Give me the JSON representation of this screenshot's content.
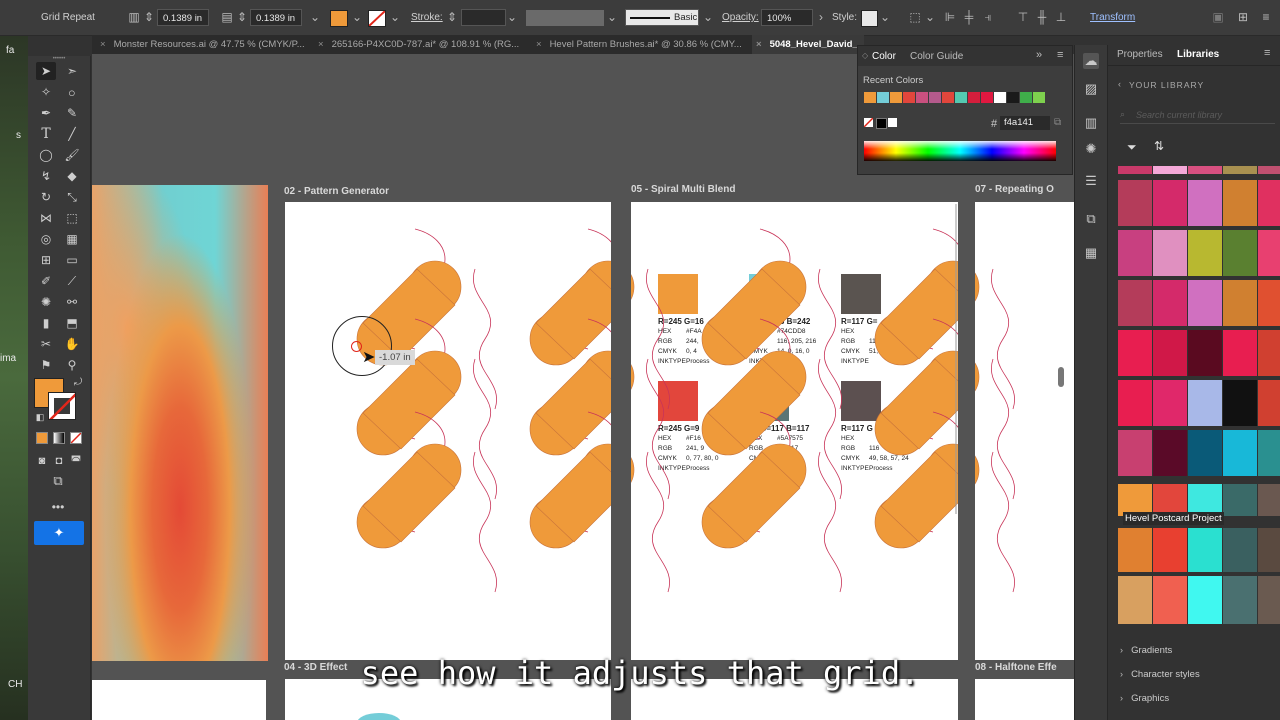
{
  "control_bar": {
    "tool_name": "Grid Repeat",
    "h_spacing": "0.1389 in",
    "v_spacing": "0.1389 in",
    "stroke_label": "Stroke:",
    "brush_preset": "Basic",
    "opacity_label": "Opacity:",
    "opacity_value": "100%",
    "style_label": "Style:",
    "transform_label": "Transform",
    "fill_color": "#ef9a3a"
  },
  "tabs": [
    {
      "label": "Monster Resources.ai @ 47.75 % (CMYK/P..."
    },
    {
      "label": "265166-P4XC0D-787.ai* @ 108.91 % (RG..."
    },
    {
      "label": "Hevel Pattern Brushes.ai* @ 30.86 % (CMY..."
    },
    {
      "label": "5048_Hevel_David_..."
    }
  ],
  "desktop_labels": [
    "fa",
    "s",
    "ima",
    "CH"
  ],
  "artboards": {
    "a1": "02 - Pattern Generator",
    "a2": "05 - Spiral Multi Blend",
    "a3": "07 - Repeating O",
    "a4": "04 - 3D Effect",
    "a5": "08 - Halftone Effe"
  },
  "cursor_readout": "-1.07 in",
  "swatches": [
    {
      "name": "R=245 G=16",
      "color": "#ef9a3a",
      "hex_label": "HEX",
      "hex": "#F4A",
      "rgb_label": "RGB",
      "rgb": "244,",
      "cmyk_label": "CMYK",
      "cmyk": "0, 4",
      "ink_label": "INKTYPE",
      "ink": "Process"
    },
    {
      "name": "64 G=245 B=242",
      "color": "#74cdd8",
      "hex_label": "HEX",
      "hex": "#74CDD8",
      "rgb_label": "RGB",
      "rgb": "116, 205, 216",
      "cmyk_label": "CMYK",
      "cmyk": "14, 0, 16, 0",
      "ink_label": "INKTYPE",
      "ink": "Process"
    },
    {
      "name": "R=117 G=",
      "color": "#5a5450",
      "hex_label": "HEX",
      "hex": "",
      "rgb_label": "RGB",
      "rgb": "116",
      "cmyk_label": "CMYK",
      "cmyk": "51,",
      "ink_label": "INKTYPE",
      "ink": ""
    },
    {
      "name": "R=245 G=9",
      "color": "#e2463c",
      "hex_label": "HEX",
      "hex": "#F16",
      "rgb_label": "RGB",
      "rgb": "241, 9",
      "cmyk_label": "CMYK",
      "cmyk": "0, 77, 80, 0",
      "ink_label": "INKTYPE",
      "ink": "Process"
    },
    {
      "name": "89 G=117 B=117",
      "color": "#5a7575",
      "hex_label": "HEX",
      "hex": "#5A7575",
      "rgb_label": "RGB",
      "rgb": "17, 117",
      "cmyk_label": "CMYK",
      "cmyk": "8, 13",
      "ink_label": "INKTYPE",
      "ink": "Process"
    },
    {
      "name": "R=117 G",
      "color": "#5c5050",
      "hex_label": "HEX",
      "hex": "",
      "rgb_label": "RGB",
      "rgb": "116",
      "cmyk_label": "CMYK",
      "cmyk": "49, 58, 57, 24",
      "ink_label": "INKTYPE",
      "ink": "Process"
    }
  ],
  "color_panel": {
    "tab_color": "Color",
    "tab_guide": "Color Guide",
    "recent_label": "Recent Colors",
    "recent_colors": [
      "#ef9a3a",
      "#74cdd8",
      "#ef9a3a",
      "#e2463c",
      "#c9507f",
      "#b45a8c",
      "#e2463c",
      "#54c9b1",
      "#d41e3c",
      "#e01840",
      "#ffffff",
      "#1a1a1a",
      "#3fae4a",
      "#7ed14e"
    ],
    "hex_symbol": "#",
    "hex_value": "f4a141"
  },
  "right_panel": {
    "tab_properties": "Properties",
    "tab_libraries": "Libraries",
    "back_label": "YOUR LIBRARY",
    "search_placeholder": "Search current library",
    "group_label": "Hevel Postcard Project",
    "sections": [
      "Gradients",
      "Character styles",
      "Graphics"
    ],
    "palette_rows": [
      [
        "#c93a6a",
        "#f4a8d8",
        "#d85080",
        "#a89050",
        "#c05070"
      ],
      [
        "#b43c5a",
        "#d42a6a",
        "#d070c0",
        "#d08030",
        "#e03060"
      ],
      [
        "#c84080",
        "#e090c0",
        "#b8b830",
        "#5a8030",
        "#e84070"
      ],
      [
        "#b43c5a",
        "#d42a6a",
        "#d070c0",
        "#d08030",
        "#e05030"
      ],
      [
        "#e81e50",
        "#d01848",
        "#5a0a20",
        "#e81e50",
        "#d04030"
      ],
      [
        "#e81e50",
        "#e0286a",
        "#a8b8e8",
        "#111111",
        "#d04030"
      ],
      [
        "#c84070",
        "#5a0a28",
        "#0a5a78",
        "#18b8d8",
        "#2a9090"
      ],
      [
        "#ef9a3a",
        "#e2463c",
        "#3ee8e0",
        "#3a6a68",
        "#6a5850"
      ],
      [
        "#e08030",
        "#e84030",
        "#2ae0d0",
        "#3a6060",
        "#5a4a40"
      ],
      [
        "#d8a060",
        "#f06050",
        "#40f8f0",
        "#4a7070",
        "#6a5a50"
      ]
    ]
  },
  "subtitle": "see how it adjusts that grid."
}
